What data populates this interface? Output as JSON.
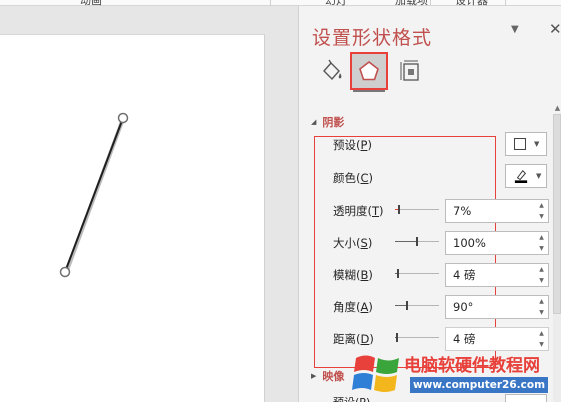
{
  "ribbon": {
    "tabs": [
      "动画",
      "幻灯",
      "加载项",
      "设计器"
    ]
  },
  "pane": {
    "title": "设置形状格式",
    "tabs": [
      {
        "name": "fill-line",
        "icon": "paint-bucket-icon"
      },
      {
        "name": "effects",
        "icon": "pentagon-icon",
        "selected": true
      },
      {
        "name": "size-properties",
        "icon": "size-layout-icon"
      }
    ],
    "shadow_section": {
      "label": "阴影",
      "expanded": true,
      "rows": [
        {
          "label": "预设",
          "key": "P",
          "control": "dropdown",
          "icon": "no-shadow-square-icon"
        },
        {
          "label": "颜色",
          "key": "C",
          "control": "color",
          "icon": "pen-color-icon"
        },
        {
          "label": "透明度",
          "key": "T",
          "control": "spin",
          "value": "7%",
          "level": 0.07
        },
        {
          "label": "大小",
          "key": "S",
          "control": "spin",
          "value": "100%",
          "level": 0.5
        },
        {
          "label": "模糊",
          "key": "B",
          "control": "spin",
          "value": "4 磅",
          "level": 0.04
        },
        {
          "label": "角度",
          "key": "A",
          "control": "spin",
          "value": "90°",
          "level": 0.25
        },
        {
          "label": "距离",
          "key": "D",
          "control": "spin",
          "value": "4 磅",
          "level": 0.02
        }
      ]
    },
    "glow_section": {
      "label": "映像",
      "expanded": false,
      "next_row_label": "预设",
      "next_row_key": "P"
    }
  },
  "watermark": {
    "text": "电脑软硬件教程网",
    "url": "www.computer26.com"
  },
  "colors": {
    "accent": "#c0504d",
    "highlight": "#e8403a",
    "watermark_blue": "#3a76c6"
  }
}
